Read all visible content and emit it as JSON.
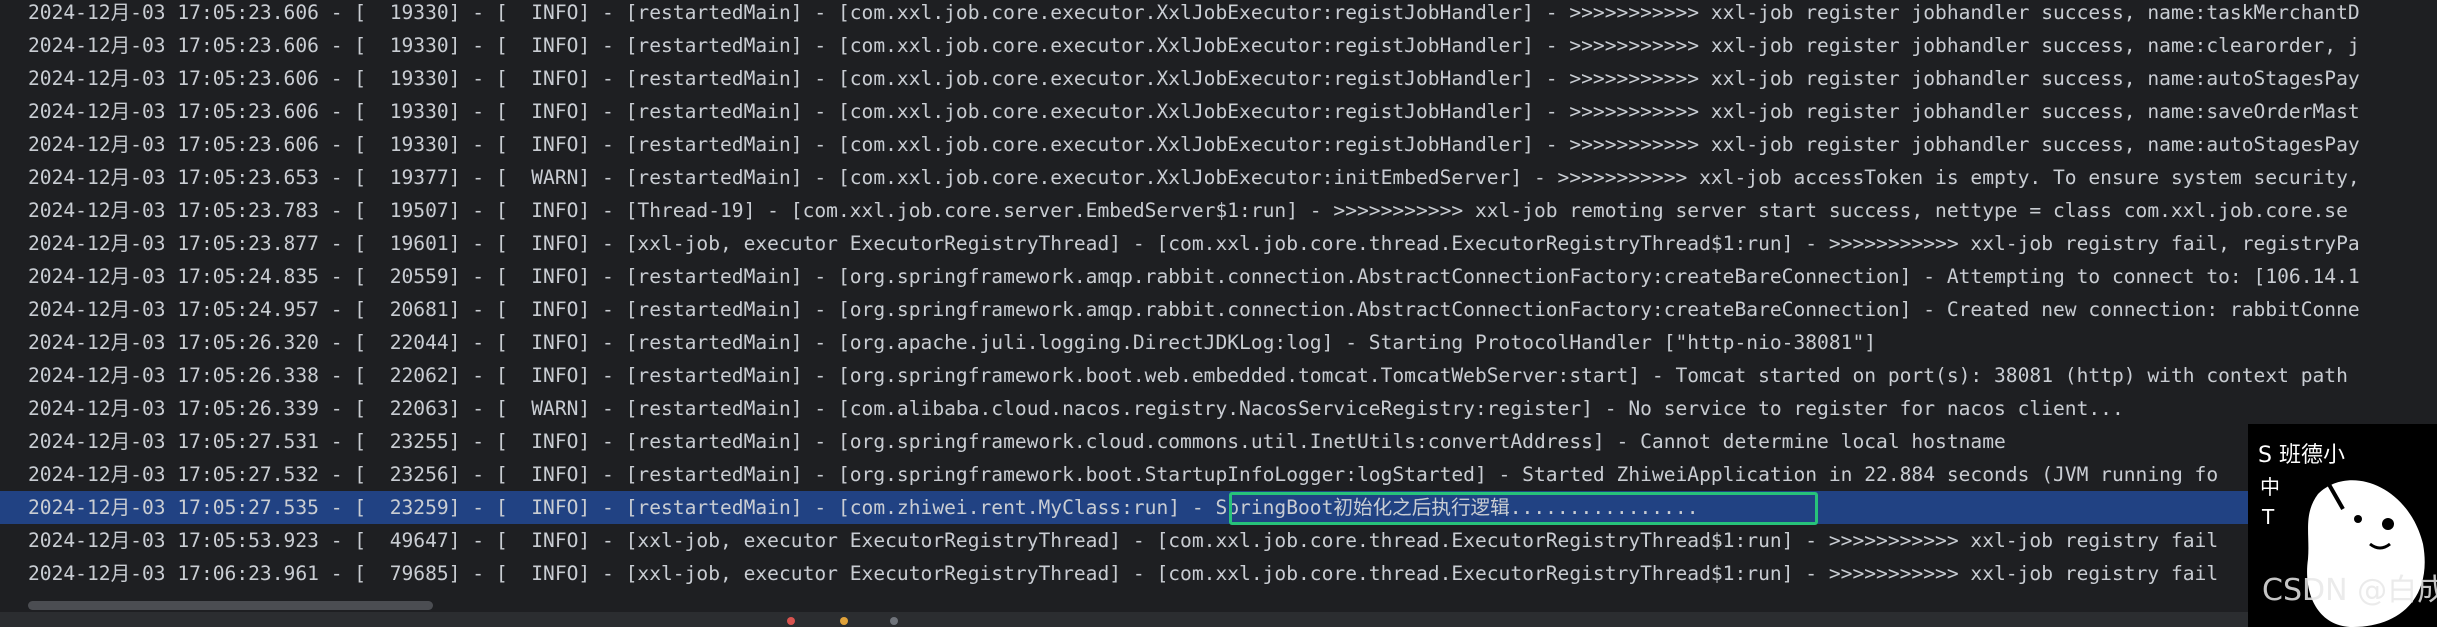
{
  "console": {
    "lines": [
      {
        "text": "2024-12月-03 17:05:23.606 - [  19330] - [  INFO] - [restartedMain] - [com.xxl.job.core.executor.XxlJobExecutor:registJobHandler] - >>>>>>>>>>> xxl-job register jobhandler success, name:taskMerchantD"
      },
      {
        "text": "2024-12月-03 17:05:23.606 - [  19330] - [  INFO] - [restartedMain] - [com.xxl.job.core.executor.XxlJobExecutor:registJobHandler] - >>>>>>>>>>> xxl-job register jobhandler success, name:clearorder, j"
      },
      {
        "text": "2024-12月-03 17:05:23.606 - [  19330] - [  INFO] - [restartedMain] - [com.xxl.job.core.executor.XxlJobExecutor:registJobHandler] - >>>>>>>>>>> xxl-job register jobhandler success, name:autoStagesPay"
      },
      {
        "text": "2024-12月-03 17:05:23.606 - [  19330] - [  INFO] - [restartedMain] - [com.xxl.job.core.executor.XxlJobExecutor:registJobHandler] - >>>>>>>>>>> xxl-job register jobhandler success, name:saveOrderMast"
      },
      {
        "text": "2024-12月-03 17:05:23.606 - [  19330] - [  INFO] - [restartedMain] - [com.xxl.job.core.executor.XxlJobExecutor:registJobHandler] - >>>>>>>>>>> xxl-job register jobhandler success, name:autoStagesPay"
      },
      {
        "text": "2024-12月-03 17:05:23.653 - [  19377] - [  WARN] - [restartedMain] - [com.xxl.job.core.executor.XxlJobExecutor:initEmbedServer] - >>>>>>>>>>> xxl-job accessToken is empty. To ensure system security,"
      },
      {
        "text": "2024-12月-03 17:05:23.783 - [  19507] - [  INFO] - [Thread-19] - [com.xxl.job.core.server.EmbedServer$1:run] - >>>>>>>>>>> xxl-job remoting server start success, nettype = class com.xxl.job.core.se"
      },
      {
        "text": "2024-12月-03 17:05:23.877 - [  19601] - [  INFO] - [xxl-job, executor ExecutorRegistryThread] - [com.xxl.job.core.thread.ExecutorRegistryThread$1:run] - >>>>>>>>>>> xxl-job registry fail, registryPa"
      },
      {
        "text": "2024-12月-03 17:05:24.835 - [  20559] - [  INFO] - [restartedMain] - [org.springframework.amqp.rabbit.connection.AbstractConnectionFactory:createBareConnection] - Attempting to connect to: [106.14.1"
      },
      {
        "text": "2024-12月-03 17:05:24.957 - [  20681] - [  INFO] - [restartedMain] - [org.springframework.amqp.rabbit.connection.AbstractConnectionFactory:createBareConnection] - Created new connection: rabbitConne"
      },
      {
        "text": "2024-12月-03 17:05:26.320 - [  22044] - [  INFO] - [restartedMain] - [org.apache.juli.logging.DirectJDKLog:log] - Starting ProtocolHandler [\"http-nio-38081\"]"
      },
      {
        "text": "2024-12月-03 17:05:26.338 - [  22062] - [  INFO] - [restartedMain] - [org.springframework.boot.web.embedded.tomcat.TomcatWebServer:start] - Tomcat started on port(s): 38081 (http) with context path"
      },
      {
        "text": "2024-12月-03 17:05:26.339 - [  22063] - [  WARN] - [restartedMain] - [com.alibaba.cloud.nacos.registry.NacosServiceRegistry:register] - No service to register for nacos client..."
      },
      {
        "text": "2024-12月-03 17:05:27.531 - [  23255] - [  INFO] - [restartedMain] - [org.springframework.cloud.commons.util.InetUtils:convertAddress] - Cannot determine local hostname"
      },
      {
        "text": "2024-12月-03 17:05:27.532 - [  23256] - [  INFO] - [restartedMain] - [org.springframework.boot.StartupInfoLogger:logStarted] - Started ZhiweiApplication in 22.884 seconds (JVM running fo"
      },
      {
        "text": "2024-12月-03 17:05:27.535 - [  23259] - [  INFO] - [restartedMain] - [com.zhiwei.rent.MyClass:run] - SpringBoot初始化之后执行逻辑................",
        "selected": true
      },
      {
        "text": "2024-12月-03 17:05:53.923 - [  49647] - [  INFO] - [xxl-job, executor ExecutorRegistryThread] - [com.xxl.job.core.thread.ExecutorRegistryThread$1:run] - >>>>>>>>>>> xxl-job registry fail"
      },
      {
        "text": "2024-12月-03 17:06:23.961 - [  79685] - [  INFO] - [xxl-job, executor ExecutorRegistryThread] - [com.xxl.job.core.thread.ExecutorRegistryThread$1:run] - >>>>>>>>>>> xxl-job registry fail"
      }
    ]
  },
  "sticker": {
    "text_line1": "S 班德小",
    "text_line2": "中",
    "text_line3": "T"
  },
  "watermark": "CSDN @白成浩",
  "colors": {
    "background": "#1e1f22",
    "text": "#c9cdd3",
    "selection": "#214283",
    "highlight_border": "#27c27a",
    "scroll_thumb": "#4b4d52",
    "dot_red": "#d9534f",
    "dot_yellow": "#e0a23a",
    "dot_gray": "#6f737a"
  },
  "icons": [
    "highlight-box",
    "sticker-avatar",
    "status-dot"
  ]
}
